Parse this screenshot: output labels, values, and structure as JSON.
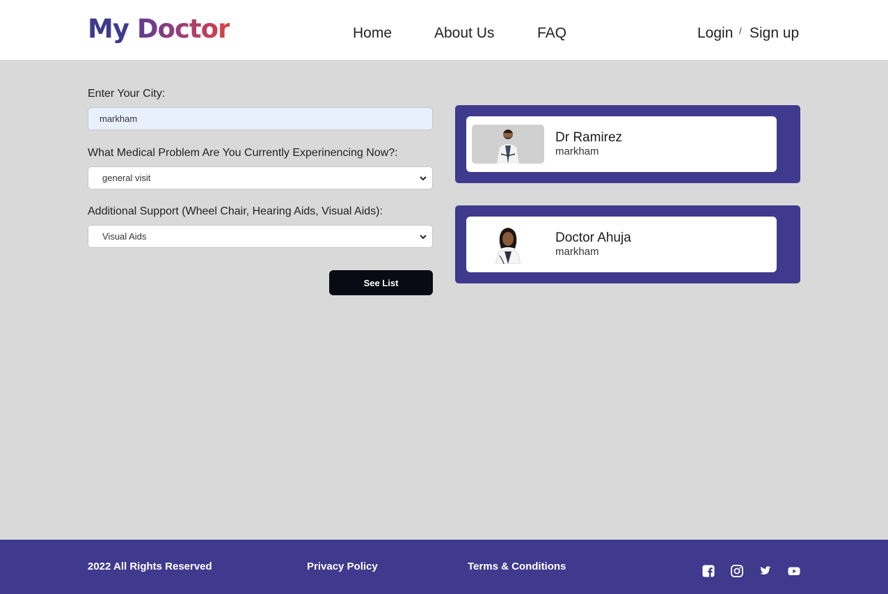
{
  "header": {
    "logo_part1": "My",
    "logo_part2": "Doctor",
    "nav": [
      "Home",
      "About Us",
      "FAQ"
    ],
    "login": "Login",
    "separator": "/",
    "signup": "Sign up"
  },
  "form": {
    "city_label": "Enter Your City:",
    "city_value": "markham",
    "problem_label": "What Medical Problem Are You Currently Experinencing Now?:",
    "problem_value": "general visit",
    "support_label": "Additional Support (Wheel Chair, Hearing Aids, Visual Aids):",
    "support_value": "Visual Aids",
    "button": "See List"
  },
  "doctors": [
    {
      "name": "Dr Ramirez",
      "city": "markham"
    },
    {
      "name": "Doctor Ahuja",
      "city": "markham"
    }
  ],
  "footer": {
    "copyright": "2022 All Rights Reserved",
    "privacy": "Privacy Policy",
    "terms": "Terms & Conditions",
    "social_icons": [
      "facebook-icon",
      "instagram-icon",
      "twitter-icon",
      "youtube-icon"
    ]
  },
  "colors": {
    "brand": "#3f3a8e",
    "accent": "#d84242",
    "background": "#d9d9d9",
    "button": "#0a0a14"
  }
}
